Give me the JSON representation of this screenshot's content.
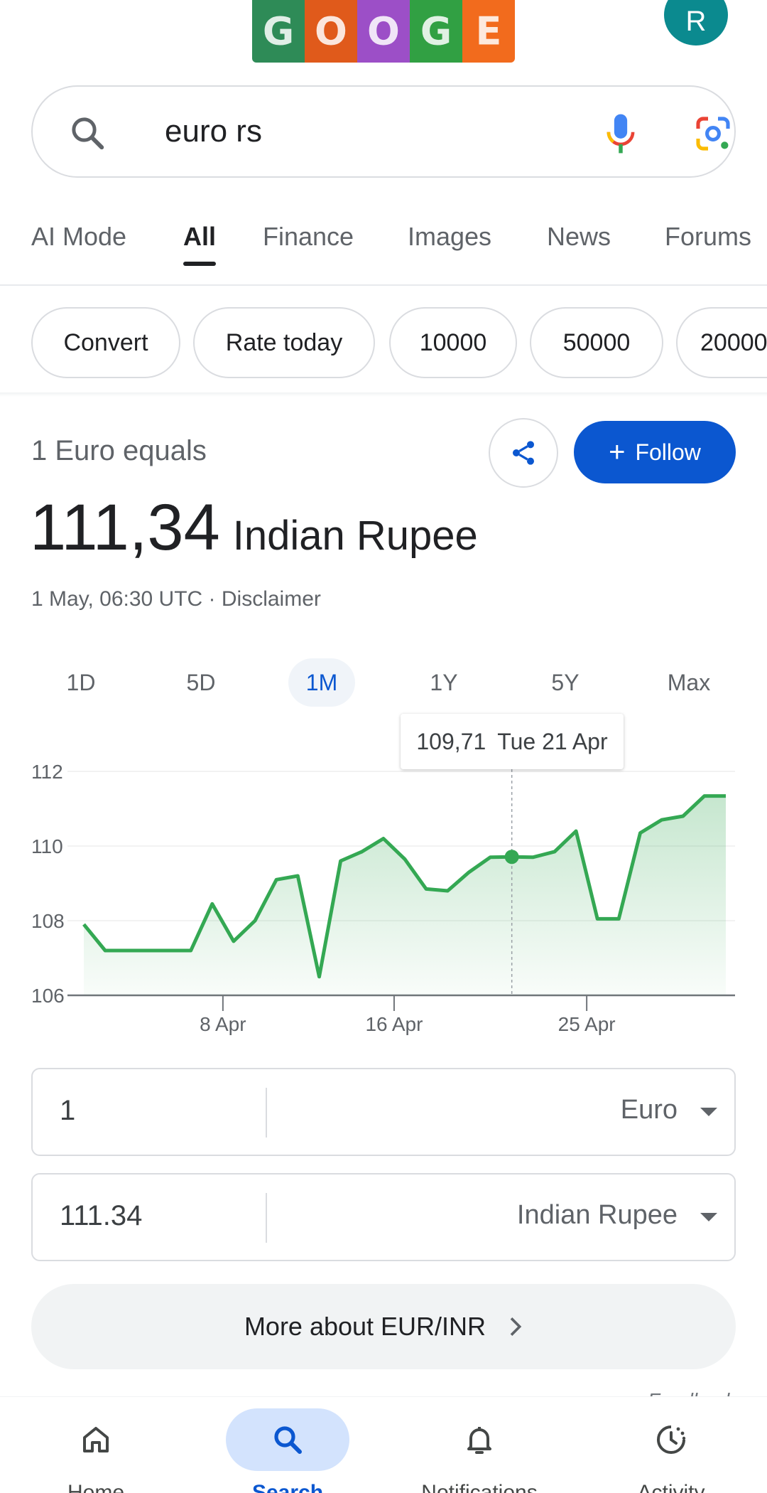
{
  "header": {
    "avatar_initial": "R",
    "doodle_colors": [
      "#2e8b57",
      "#e05a1b",
      "#9c4fc7",
      "#31a043",
      "#f26b1d"
    ]
  },
  "search": {
    "query": "euro rs"
  },
  "tabs": [
    {
      "label": "AI Mode",
      "active": false
    },
    {
      "label": "All",
      "active": true
    },
    {
      "label": "Finance",
      "active": false
    },
    {
      "label": "Images",
      "active": false
    },
    {
      "label": "News",
      "active": false
    },
    {
      "label": "Forums",
      "active": false
    }
  ],
  "chips": [
    "Convert",
    "Rate today",
    "10000",
    "50000",
    "20000"
  ],
  "currency": {
    "equals_label": "1 Euro equals",
    "value": "111,34",
    "target_currency": "Indian Rupee",
    "timestamp": "1 May, 06:30 UTC · Disclaimer",
    "follow_label": "Follow"
  },
  "ranges": [
    {
      "label": "1D",
      "active": false
    },
    {
      "label": "5D",
      "active": false
    },
    {
      "label": "1M",
      "active": true
    },
    {
      "label": "1Y",
      "active": false
    },
    {
      "label": "5Y",
      "active": false
    },
    {
      "label": "Max",
      "active": false
    }
  ],
  "tooltip": {
    "value": "109,71",
    "date": "Tue 21 Apr"
  },
  "chart_data": {
    "type": "area",
    "title": "",
    "xlabel": "",
    "ylabel": "",
    "ylim": [
      106,
      112
    ],
    "yticks": [
      106,
      108,
      110,
      112
    ],
    "xtick_labels": [
      {
        "label": "8 Apr",
        "index": 6.5
      },
      {
        "label": "16 Apr",
        "index": 14.5
      },
      {
        "label": "25 Apr",
        "index": 23.5
      }
    ],
    "highlight_index": 20,
    "series": [
      {
        "name": "EUR/INR",
        "color": "#34a853",
        "values": [
          107.9,
          107.2,
          107.2,
          107.2,
          107.2,
          107.2,
          108.45,
          107.45,
          108.0,
          109.1,
          109.2,
          106.5,
          109.6,
          109.85,
          110.2,
          109.65,
          108.85,
          108.8,
          109.3,
          109.7,
          109.71,
          109.7,
          109.85,
          110.4,
          108.05,
          108.05,
          110.35,
          110.7,
          110.8,
          111.34,
          111.34
        ]
      }
    ]
  },
  "converter": {
    "from_amount": "1",
    "from_currency": "Euro",
    "to_amount": "111.34",
    "to_currency": "Indian Rupee"
  },
  "more": {
    "label": "More about EUR/INR"
  },
  "feedback_label": "Feedback",
  "bottom_nav": [
    {
      "label": "Home",
      "icon": "home-icon",
      "active": false
    },
    {
      "label": "Search",
      "icon": "search-icon",
      "active": true
    },
    {
      "label": "Notifications",
      "icon": "bell-icon",
      "active": false
    },
    {
      "label": "Activity",
      "icon": "activity-icon",
      "active": false
    }
  ]
}
